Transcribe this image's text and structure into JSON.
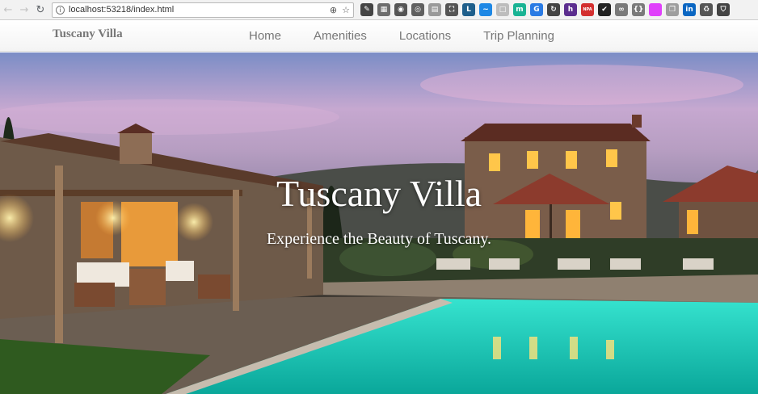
{
  "browser": {
    "url": "localhost:53218/index.html",
    "extensions": [
      {
        "name": "stylus-extension-icon",
        "color": "#444444",
        "glyph": "✎"
      },
      {
        "name": "qr-extension-icon",
        "color": "#6d6d6d",
        "glyph": "▦"
      },
      {
        "name": "chrome-extension-icon",
        "color": "#555555",
        "glyph": "◉"
      },
      {
        "name": "search-extension-icon",
        "color": "#606060",
        "glyph": "◎"
      },
      {
        "name": "page-extension-icon",
        "color": "#9a9a9a",
        "glyph": "▤"
      },
      {
        "name": "expand-extension-icon",
        "color": "#555555",
        "glyph": "⛶"
      },
      {
        "name": "l-extension-icon",
        "color": "#1f5f8b",
        "glyph": "L"
      },
      {
        "name": "wave-extension-icon",
        "color": "#1e88e5",
        "glyph": "~"
      },
      {
        "name": "box-extension-icon",
        "color": "#bdbdbd",
        "glyph": "□"
      },
      {
        "name": "green-circle-extension-icon",
        "color": "#19b394",
        "glyph": "m"
      },
      {
        "name": "grammar-extension-icon",
        "color": "#2a7be4",
        "glyph": "G"
      },
      {
        "name": "refresh-extension-icon",
        "color": "#444444",
        "glyph": "↻"
      },
      {
        "name": "h-extension-icon",
        "color": "#5b2d8e",
        "glyph": "h"
      },
      {
        "name": "npa-extension-icon",
        "color": "#d32f2f",
        "glyph": "NPA"
      },
      {
        "name": "check-extension-icon",
        "color": "#222222",
        "glyph": "✔"
      },
      {
        "name": "infinity-extension-icon",
        "color": "#7a7a7a",
        "glyph": "∞"
      },
      {
        "name": "json-extension-icon",
        "color": "#7a7a7a",
        "glyph": "{}"
      },
      {
        "name": "gradient-extension-icon",
        "color": "#e040fb",
        "glyph": " "
      },
      {
        "name": "bookmark-extension-icon",
        "color": "#9e9e9e",
        "glyph": "❐"
      },
      {
        "name": "linkedin-extension-icon",
        "color": "#0a66c2",
        "glyph": "in"
      },
      {
        "name": "recycle-extension-icon",
        "color": "#555555",
        "glyph": "♻"
      },
      {
        "name": "shield-extension-icon",
        "color": "#444444",
        "glyph": "⛉"
      }
    ]
  },
  "site": {
    "brand": "Tuscany Villa",
    "menu": {
      "home": "Home",
      "amenities": "Amenities",
      "locations": "Locations",
      "trip_planning": "Trip Planning"
    }
  },
  "hero": {
    "title": "Tuscany Villa",
    "subtitle": "Experience the Beauty of Tuscany."
  }
}
